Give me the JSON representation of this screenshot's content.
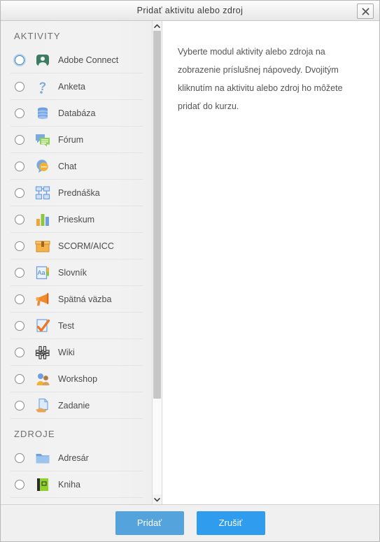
{
  "dialog": {
    "title": "Pridať aktivitu alebo zdroj",
    "close_icon": "close-icon"
  },
  "left_panel": {
    "sections": [
      {
        "heading": "AKTIVITY",
        "items": [
          {
            "label": "Adobe Connect",
            "icon": "adobe-connect-icon",
            "selected": true
          },
          {
            "label": "Anketa",
            "icon": "question-mark-icon",
            "selected": false
          },
          {
            "label": "Databáza",
            "icon": "database-icon",
            "selected": false
          },
          {
            "label": "Fórum",
            "icon": "forum-icon",
            "selected": false
          },
          {
            "label": "Chat",
            "icon": "chat-bubble-icon",
            "selected": false
          },
          {
            "label": "Prednáška",
            "icon": "lesson-flowchart-icon",
            "selected": false
          },
          {
            "label": "Prieskum",
            "icon": "bar-chart-icon",
            "selected": false
          },
          {
            "label": "SCORM/AICC",
            "icon": "package-box-icon",
            "selected": false
          },
          {
            "label": "Slovník",
            "icon": "glossary-icon",
            "selected": false
          },
          {
            "label": "Spätná väzba",
            "icon": "megaphone-icon",
            "selected": false
          },
          {
            "label": "Test",
            "icon": "quiz-checkmark-icon",
            "selected": false
          },
          {
            "label": "Wiki",
            "icon": "wiki-icon",
            "selected": false
          },
          {
            "label": "Workshop",
            "icon": "workshop-people-icon",
            "selected": false
          },
          {
            "label": "Zadanie",
            "icon": "assignment-hand-icon",
            "selected": false
          }
        ]
      },
      {
        "heading": "ZDROJE",
        "items": [
          {
            "label": "Adresár",
            "icon": "folder-icon",
            "selected": false
          },
          {
            "label": "Kniha",
            "icon": "book-icon",
            "selected": false
          }
        ]
      }
    ],
    "scrollbar": {
      "up_arrow_icon": "chevron-up-icon",
      "down_arrow_icon": "chevron-down-icon"
    }
  },
  "right_panel": {
    "help_text": "Vyberte modul aktivity alebo zdroja na zobrazenie príslušnej nápovedy. Dvojitým kliknutím na aktivitu alebo zdroj ho môžete pridať do kurzu."
  },
  "footer": {
    "add_label": "Pridať",
    "cancel_label": "Zrušiť"
  },
  "colors": {
    "add_button": "#54a3dd",
    "cancel_button": "#2f9ced",
    "focus_ring": "#3b85c4",
    "panel_bg": "#f1f1f1",
    "footer_bg": "#f0f0f0"
  }
}
